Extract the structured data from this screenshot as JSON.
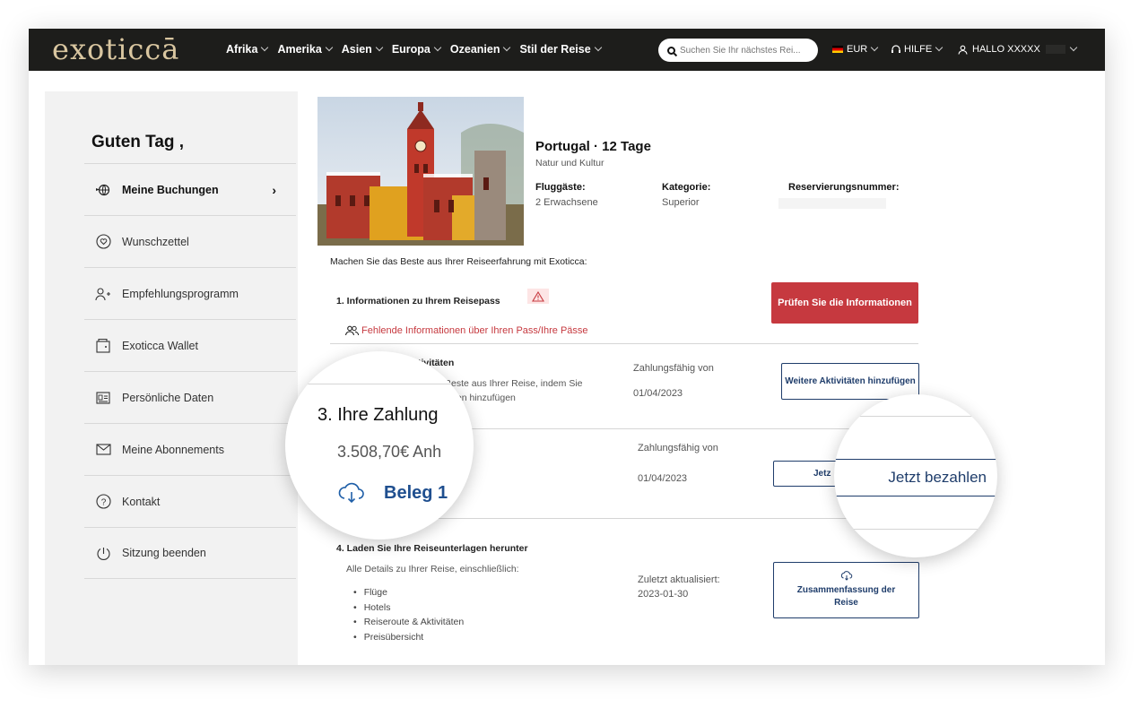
{
  "header": {
    "logo": "exoticcā",
    "nav": [
      "Afrika",
      "Amerika",
      "Asien",
      "Europa",
      "Ozeanien",
      "Stil der Reise"
    ],
    "search_placeholder": "Suchen Sie Ihr nächstes Rei...",
    "currency": "EUR",
    "help": "HILFE",
    "user": "HALLO XXXXX"
  },
  "sidebar": {
    "greeting": "Guten Tag ,",
    "items": [
      {
        "label": "Meine Buchungen",
        "icon": "globe-plane-icon",
        "active": true
      },
      {
        "label": "Wunschzettel",
        "icon": "heart-icon"
      },
      {
        "label": "Empfehlungsprogramm",
        "icon": "add-user-icon"
      },
      {
        "label": "Exoticca Wallet",
        "icon": "wallet-icon"
      },
      {
        "label": "Persönliche Daten",
        "icon": "id-card-icon"
      },
      {
        "label": "Meine Abonnements",
        "icon": "mail-icon"
      },
      {
        "label": "Kontakt",
        "icon": "question-icon"
      },
      {
        "label": "Sitzung beenden",
        "icon": "power-icon"
      }
    ]
  },
  "trip": {
    "title": "Portugal · 12 Tage",
    "subtitle": "Natur und Kultur",
    "guests_label": "Fluggäste:",
    "guests_value": "2 Erwachsene",
    "category_label": "Kategorie:",
    "category_value": "Superior",
    "reservation_label": "Reservierungsnummer:",
    "reservation_value": ""
  },
  "main": {
    "intro": "Machen Sie das Beste aus Ihrer Reiseerfahrung mit Exoticca:",
    "section1": {
      "title": "1. Informationen zu Ihrem Reisepass",
      "missing": "Fehlende Informationen über Ihren Pass/Ihre Pässe",
      "button": "Prüfen Sie die Informationen"
    },
    "section2": {
      "title_partial": "tivitäten",
      "desc_line1": "Beste aus Ihrer Reise, indem Sie",
      "desc_line2": "ten hinzufügen",
      "pay_label": "Zahlungsfähig von",
      "pay_date": "01/04/2023",
      "button": "Weitere Aktivitäten hinzufügen"
    },
    "section3": {
      "pay_label": "Zahlungsfähig von",
      "pay_date": "01/04/2023",
      "button_partial": "Jetz"
    },
    "section4": {
      "title": "4. Laden Sie Ihre Reiseunterlagen herunter",
      "desc": "Alle Details zu Ihrer Reise, einschließlich:",
      "bullets": [
        "Flüge",
        "Hotels",
        "Reiseroute & Aktivitäten",
        "Preisübersicht"
      ],
      "updated_label": "Zuletzt aktualisiert:",
      "updated_date": "2023-01-30",
      "button": "Zusammenfassung der Reise"
    }
  },
  "magnifier_left": {
    "title": "3. Ihre Zahlung",
    "amount": "3.508,70€ Anh",
    "receipt": "Beleg 1"
  },
  "magnifier_right": {
    "button": "Jetzt bezahlen"
  },
  "colors": {
    "header_bg": "#1d1d1b",
    "logo": "#d9c6a0",
    "accent_red": "#c6393f",
    "navy": "#1f3d6b"
  }
}
